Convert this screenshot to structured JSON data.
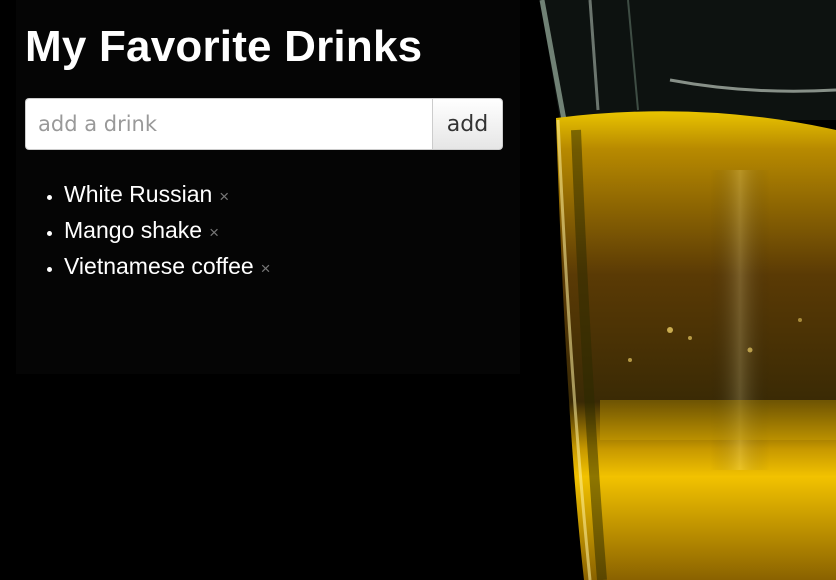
{
  "app": {
    "title": "My Favorite Drinks"
  },
  "form": {
    "input_placeholder": "add a drink",
    "input_value": "",
    "add_label": "add"
  },
  "drinks": [
    {
      "name": "White Russian",
      "remove_icon": "×"
    },
    {
      "name": "Mango shake",
      "remove_icon": "×"
    },
    {
      "name": "Vietnamese coffee",
      "remove_icon": "×"
    }
  ],
  "colors": {
    "background": "#000000",
    "title_text": "#ffffff",
    "remove_icon": "#777777",
    "drink_accent": "#e0b000"
  }
}
